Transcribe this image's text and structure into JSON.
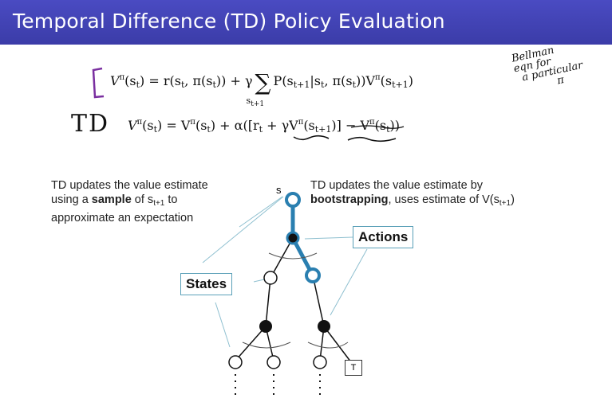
{
  "header": {
    "title": "Temporal Difference (TD) Policy Evaluation"
  },
  "equations": {
    "bellman": {
      "lhs": "V",
      "lhs_sup": "π",
      "lhs_arg": "(s",
      "lhs_arg_sub": "t",
      "eq_part1": ") = r(s",
      "r_sub": "t",
      "eq_part2": ", π(s",
      "pi_sub": "t",
      "eq_part3": ")) + γ",
      "sum_symbol": "∑",
      "sum_sub": "s",
      "sum_sub_sub": "t+1",
      "eq_part4": "P(s",
      "p_sub": "t+1",
      "eq_part5": "|s",
      "p_cond_sub": "t",
      "eq_part6": ", π(s",
      "p_pi_sub": "t",
      "eq_part7": "))V",
      "v2_sup": "π",
      "eq_part8": "(s",
      "v2_sub": "t+1",
      "eq_part9": ")"
    },
    "td": {
      "lhs": "V",
      "lhs_sup": "π",
      "part1": "(s",
      "sub1": "t",
      "part2": ") = V",
      "sup2": "π",
      "part3": "(s",
      "sub3": "t",
      "part4": ") + α([r",
      "sub4": "t",
      "part5": " + γV",
      "sup5": "π",
      "part6": "(s",
      "sub6": "t+1",
      "part7": ")] − V",
      "sup7": "π",
      "part8": "(s",
      "sub8": "t",
      "part9": "))"
    }
  },
  "handwriting": {
    "td_label": "TD",
    "bellman_note_line1": "Bellman",
    "bellman_note_line2": "eqn for",
    "bellman_note_line3": "a particular",
    "bellman_note_line4": "π"
  },
  "notes": {
    "left": {
      "line1": "TD updates the value estimate",
      "line2_pre": "using a ",
      "line2_bold": "sample",
      "line2_mid": " of s",
      "line2_sub": "t+1",
      "line2_post": " to",
      "line3": "approximate an expectation"
    },
    "right": {
      "line1": "TD updates the value estimate by",
      "line2_bold": "bootstrapping",
      "line2_post": ", uses estimate of V(s",
      "line2_sub": "t+1",
      "line2_end": ")"
    }
  },
  "tree": {
    "root_label": "s",
    "states_label": "States",
    "actions_label": "Actions",
    "terminal_label": "T",
    "highlight_color": "#2a7fb0"
  }
}
